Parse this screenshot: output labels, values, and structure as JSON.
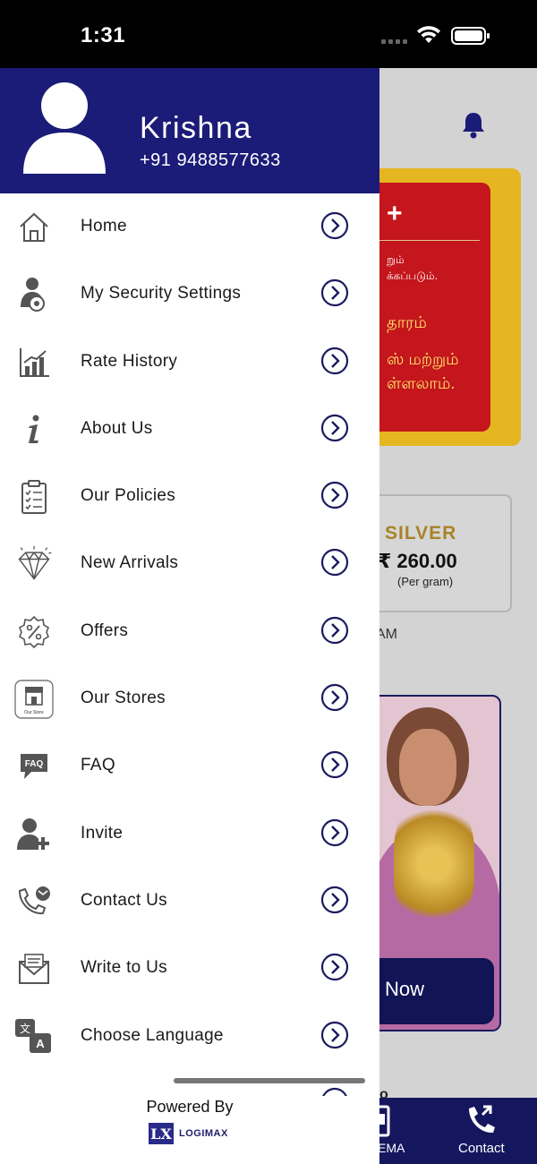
{
  "status_bar": {
    "time": "1:31"
  },
  "user": {
    "name": "Krishna",
    "phone": "+91 9488577633"
  },
  "menu": [
    {
      "label": "Home",
      "icon": "home-icon"
    },
    {
      "label": "My Security Settings",
      "icon": "security-settings-icon"
    },
    {
      "label": "Rate History",
      "icon": "chart-icon"
    },
    {
      "label": "About Us",
      "icon": "info-icon"
    },
    {
      "label": "Our Policies",
      "icon": "clipboard-icon"
    },
    {
      "label": "New Arrivals",
      "icon": "diamond-icon"
    },
    {
      "label": "Offers",
      "icon": "discount-badge-icon"
    },
    {
      "label": "Our Stores",
      "icon": "store-icon"
    },
    {
      "label": "FAQ",
      "icon": "faq-icon"
    },
    {
      "label": "Invite",
      "icon": "invite-icon"
    },
    {
      "label": "Contact Us",
      "icon": "contact-icon"
    },
    {
      "label": "Write to Us",
      "icon": "envelope-icon"
    },
    {
      "label": "Choose Language",
      "icon": "language-icon"
    }
  ],
  "store_icon_caption": "Our Store",
  "footer": {
    "powered_by": "Powered By",
    "brand": "LOGIMAX",
    "brand_mark": "LX"
  },
  "background": {
    "promo_plus": "+",
    "promo_small_1": "றும்",
    "promo_small_2": "க்கப்படும்.",
    "promo_big_1": "தாரம்",
    "promo_big_2": "ஸ் மற்றும்",
    "promo_big_3": "ள்ளலாம்.",
    "silver_label": "SILVER",
    "silver_price": "₹ 260.00",
    "silver_unit": "(Per gram)",
    "time_fragment": "AM",
    "cta": "Now",
    "nav_left": "EMA",
    "nav_right": "Contact",
    "stub": "o"
  },
  "colors": {
    "primary": "#1b1b78",
    "accent_red": "#c4161c",
    "accent_gold": "#e5b622"
  }
}
